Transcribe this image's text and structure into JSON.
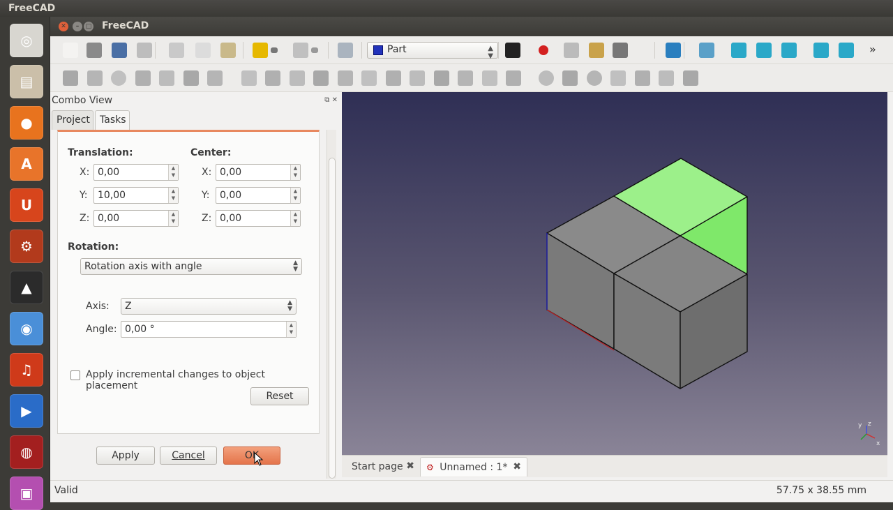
{
  "top_bar": {
    "app_name": "FreeCAD"
  },
  "launcher": {
    "items": [
      {
        "name": "ubuntu-home-icon",
        "glyph": "◎",
        "color": "#d8d6d0"
      },
      {
        "name": "files-icon",
        "glyph": "▤",
        "color": "#cbbfa9"
      },
      {
        "name": "firefox-icon",
        "glyph": "●",
        "color": "#e8731e"
      },
      {
        "name": "software-center-icon",
        "glyph": "A",
        "color": "#e8742a"
      },
      {
        "name": "ubuntu-one-icon",
        "glyph": "U",
        "color": "#d7451c"
      },
      {
        "name": "system-settings-icon",
        "glyph": "⚙",
        "color": "#b23a1c"
      },
      {
        "name": "inkscape-icon",
        "glyph": "▲",
        "color": "#2b2b2b"
      },
      {
        "name": "chromium-icon",
        "glyph": "◉",
        "color": "#4a8fd8"
      },
      {
        "name": "audacity-icon",
        "glyph": "♫",
        "color": "#cf3a1a"
      },
      {
        "name": "media-player-icon",
        "glyph": "▶",
        "color": "#2a6cc8"
      },
      {
        "name": "screen-recorder-icon",
        "glyph": "◍",
        "color": "#a31f1f"
      },
      {
        "name": "app-icon-bottom",
        "glyph": "▣",
        "color": "#b44fb0"
      }
    ]
  },
  "window": {
    "title": "FreeCAD"
  },
  "toolbar": {
    "workbench": "Part",
    "row1_icons": [
      "new-file-icon",
      "open-file-icon",
      "save-icon",
      "print-icon",
      "cut-icon",
      "copy-icon",
      "paste-icon",
      "undo-icon",
      "undo-dropdown-icon",
      "redo-icon",
      "redo-dropdown-icon",
      "refresh-icon",
      "whats-this-icon",
      "macro-record-icon",
      "macro-stop-icon",
      "macro-edit-icon",
      "macro-run-icon",
      "fit-all-icon",
      "axonometric-view-icon",
      "front-view-icon",
      "top-view-icon",
      "right-view-icon",
      "rear-view-icon",
      "bottom-view-icon",
      "toolbar-overflow-icon"
    ],
    "row2_icons": [
      "box-icon",
      "cylinder-icon",
      "sphere-icon",
      "cone-icon",
      "torus-icon",
      "create-primitives-icon",
      "shape-builder-icon",
      "extrude-icon",
      "revolve-icon",
      "mirror-icon",
      "fillet-icon",
      "chamfer-icon",
      "make-face-icon",
      "ruled-surface-icon",
      "loft-icon",
      "sweep-icon",
      "section-icon",
      "cross-sections-icon",
      "offset-icon",
      "union-icon",
      "cut-boolean-icon",
      "common-icon",
      "section-boolean-icon",
      "boolean-icon",
      "check-geometry-icon",
      "thickness-icon"
    ]
  },
  "combo_view": {
    "title": "Combo View",
    "tabs": [
      "Project",
      "Tasks"
    ],
    "translation": {
      "label": "Translation:",
      "x_label": "X:",
      "x_value": "0,00",
      "y_label": "Y:",
      "y_value": "10,00",
      "z_label": "Z:",
      "z_value": "0,00"
    },
    "center": {
      "label": "Center:",
      "x_label": "X:",
      "x_value": "0,00",
      "y_label": "Y:",
      "y_value": "0,00",
      "z_label": "Z:",
      "z_value": "0,00"
    },
    "rotation": {
      "label": "Rotation:",
      "mode": "Rotation axis with angle",
      "axis_label": "Axis:",
      "axis_value": "Z",
      "angle_label": "Angle:",
      "angle_value": "0,00 °"
    },
    "incremental_label": "Apply incremental changes to object placement",
    "incremental_checked": false,
    "reset_label": "Reset",
    "apply_label": "Apply",
    "cancel_label": "Cancel",
    "ok_label": "OK"
  },
  "viewport": {
    "axis_x": "x",
    "axis_y": "y",
    "axis_z": "z",
    "selected_color": "#8ef07a",
    "object_color": "#7d7d7d"
  },
  "document_tabs": [
    {
      "label": "Start page",
      "active": false
    },
    {
      "label": "Unnamed : 1*",
      "active": true
    }
  ],
  "status_bar": {
    "message": "Valid",
    "dimensions": "57.75 x 38.55 mm"
  }
}
